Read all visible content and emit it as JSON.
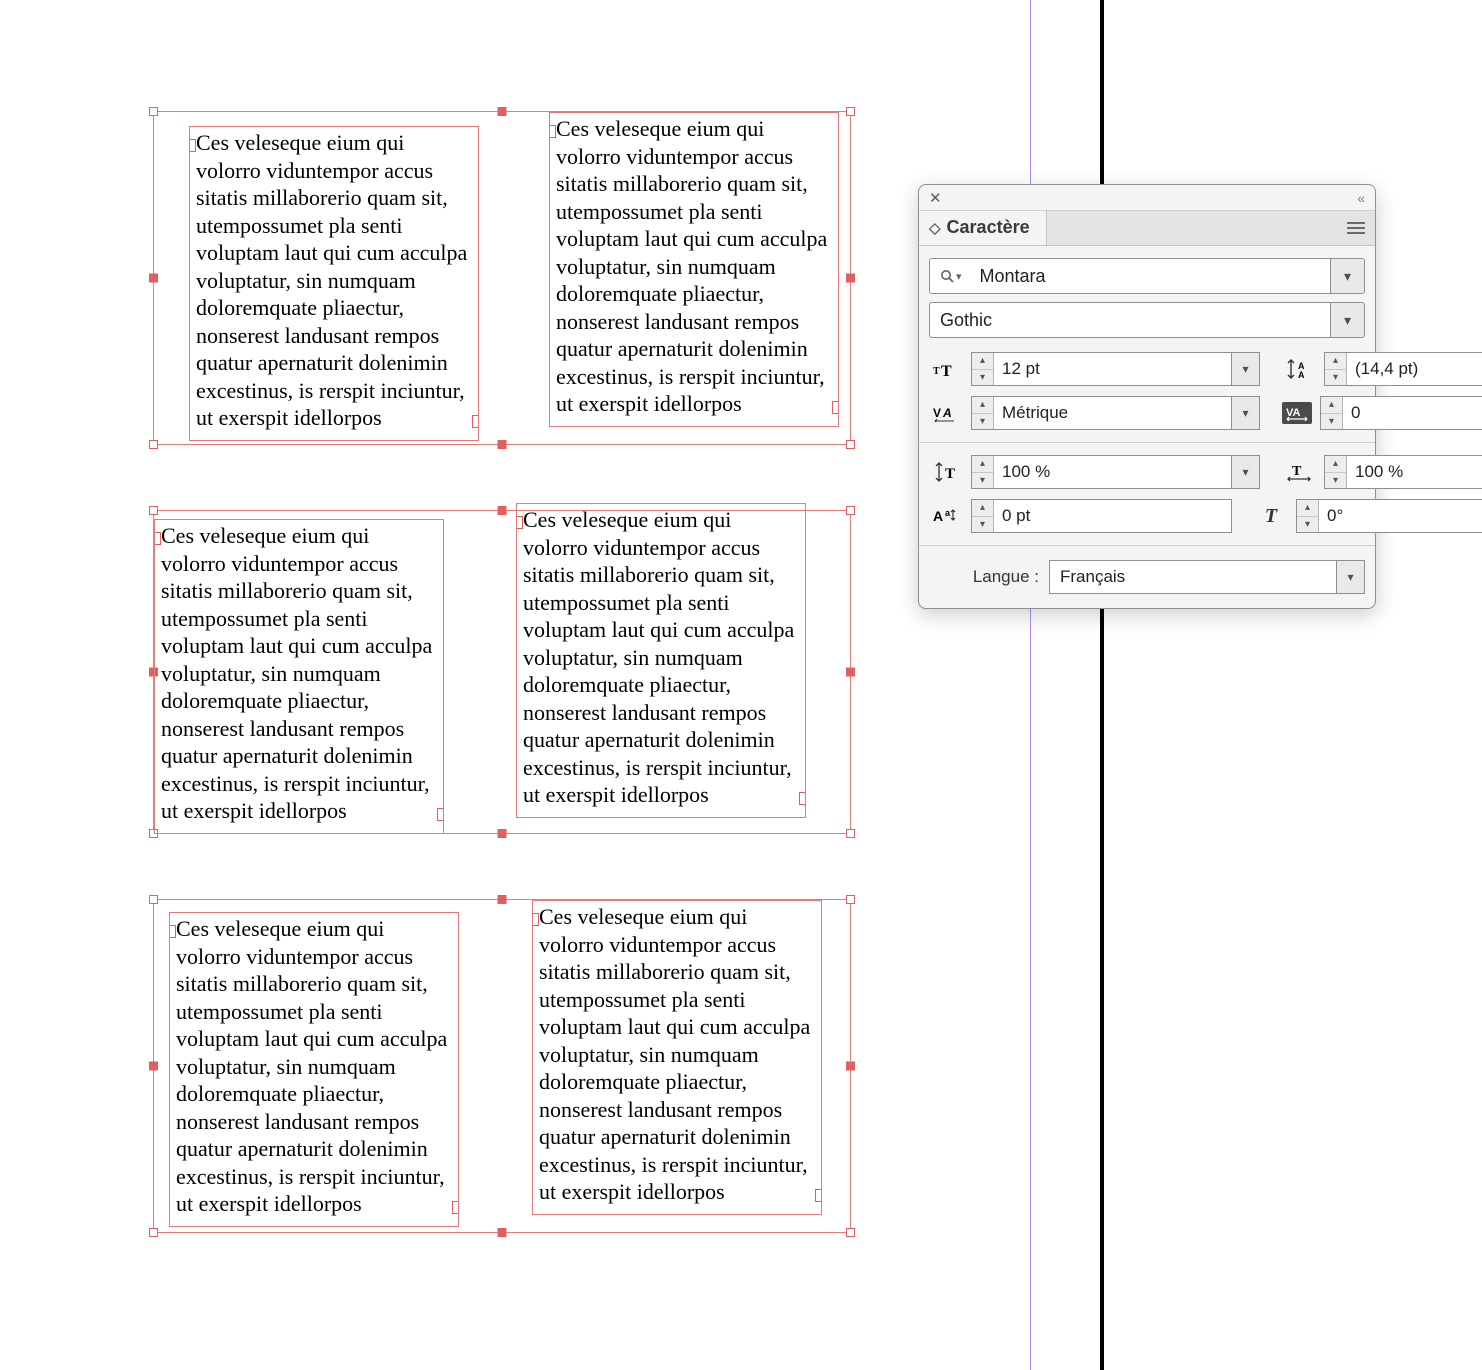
{
  "frame_text": "Ces veleseque eium qui volorro viduntempor accus sitatis millaborerio quam sit, utempossumet pla senti voluptam laut qui cum acculpa voluptatur, sin numquam doloremquate pliaectur, nonserest landusant rempos quatur apernaturit dolenimin excestinus, is rerspit inciuntur, ut exerspit idellorpos",
  "panel": {
    "title": "Caractère",
    "font_family": "Montara",
    "font_family_placeholder": "",
    "font_style": "Gothic",
    "size": "12 pt",
    "leading": "(14,4 pt)",
    "kerning": "Métrique",
    "tracking": "0",
    "vscale": "100 %",
    "hscale": "100 %",
    "baseline": "0 pt",
    "skew": "0°",
    "language_label": "Langue :",
    "language": "Français"
  }
}
